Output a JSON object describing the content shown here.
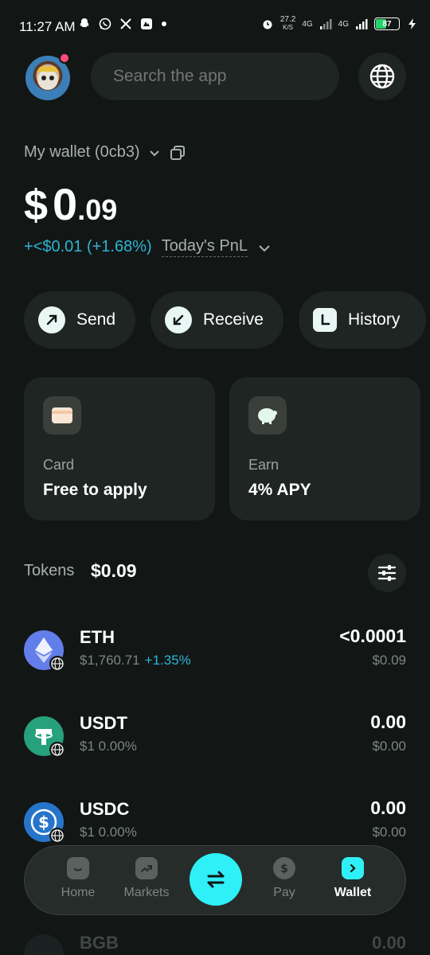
{
  "status_bar": {
    "time": "11:27 AM",
    "network_speed": "27.2",
    "network_unit": "K/S",
    "signal1": "4G",
    "signal2": "4G",
    "battery": "87"
  },
  "header": {
    "search_placeholder": "Search the app"
  },
  "wallet": {
    "name": "My wallet (0cb3)",
    "balance_currency": "$",
    "balance_whole": "0",
    "balance_decimal": ".09",
    "pnl_value": "+<$0.01 (+1.68%)",
    "pnl_label": "Today's PnL"
  },
  "actions": [
    {
      "label": "Send"
    },
    {
      "label": "Receive"
    },
    {
      "label": "History"
    }
  ],
  "cards": [
    {
      "title": "Card",
      "subtitle": "Free to apply"
    },
    {
      "title": "Earn",
      "subtitle": "4%  APY"
    }
  ],
  "tokens": {
    "label": "Tokens",
    "total": "$0.09",
    "items": [
      {
        "symbol": "ETH",
        "price": "$1,760.71",
        "change": "+1.35%",
        "amount": "<0.0001",
        "value": "$0.09",
        "color": "#627eea"
      },
      {
        "symbol": "USDT",
        "price": "$1 0.00%",
        "change": "",
        "amount": "0.00",
        "value": "$0.00",
        "color": "#26a17b"
      },
      {
        "symbol": "USDC",
        "price": "$1 0.00%",
        "change": "",
        "amount": "0.00",
        "value": "$0.00",
        "color": "#2775ca"
      }
    ],
    "peek": {
      "symbol": "BGB",
      "amount": "0.00"
    }
  },
  "nav": [
    {
      "label": "Home",
      "active": false
    },
    {
      "label": "Markets",
      "active": false
    },
    {
      "label": "Pay",
      "active": false
    },
    {
      "label": "Wallet",
      "active": true
    }
  ],
  "colors": {
    "background": "#121615",
    "accent": "#2ff0f6",
    "positive": "#2fb4d6"
  }
}
